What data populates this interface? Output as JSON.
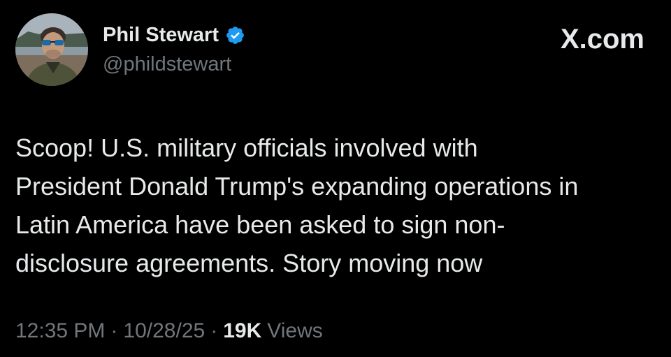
{
  "author": {
    "name": "Phil Stewart",
    "handle": "@phildstewart",
    "verified": true
  },
  "site": {
    "label": "X.com"
  },
  "tweet": {
    "text": "Scoop! U.S. military officials involved with\nPresident Donald Trump's expanding operations in\nLatin America have been asked to sign non-\ndisclosure agreements. Story moving now"
  },
  "meta": {
    "time": "12:35 PM",
    "separator": "·",
    "date": "10/28/25",
    "views_count": "19K",
    "views_label": "Views"
  },
  "icons": {
    "verified": "verified-badge-icon"
  },
  "colors": {
    "background": "#000000",
    "primary_text": "#e7e9ea",
    "secondary_text": "#71767b",
    "verified_blue": "#1d9bf0"
  }
}
